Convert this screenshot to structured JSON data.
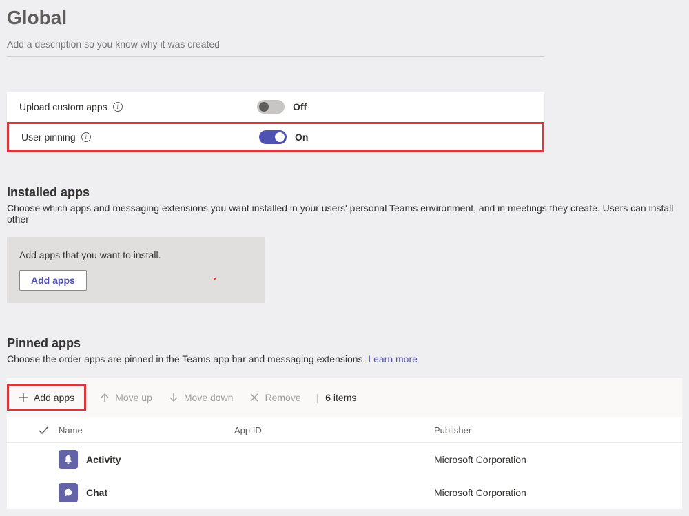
{
  "page_title": "Global",
  "description_placeholder": "Add a description so you know why it was created",
  "settings": {
    "upload_custom_apps": {
      "label": "Upload custom apps",
      "state_text": "Off"
    },
    "user_pinning": {
      "label": "User pinning",
      "state_text": "On"
    }
  },
  "installed_apps": {
    "heading": "Installed apps",
    "desc": "Choose which apps and messaging extensions you want installed in your users' personal Teams environment, and in meetings they create. Users can install other",
    "card_text": "Add apps that you want to install.",
    "add_button": "Add apps"
  },
  "pinned_apps": {
    "heading": "Pinned apps",
    "desc_pre": "Choose the order apps are pinned in the Teams app bar and messaging extensions. ",
    "learn_more": "Learn more",
    "toolbar": {
      "add_apps": "Add apps",
      "move_up": "Move up",
      "move_down": "Move down",
      "remove": "Remove",
      "count_num": "6",
      "count_label": " items"
    },
    "columns": {
      "name": "Name",
      "app_id": "App ID",
      "publisher": "Publisher"
    },
    "rows": [
      {
        "name": "Activity",
        "app_id": "",
        "publisher": "Microsoft Corporation",
        "icon": "bell"
      },
      {
        "name": "Chat",
        "app_id": "",
        "publisher": "Microsoft Corporation",
        "icon": "chat"
      }
    ]
  }
}
